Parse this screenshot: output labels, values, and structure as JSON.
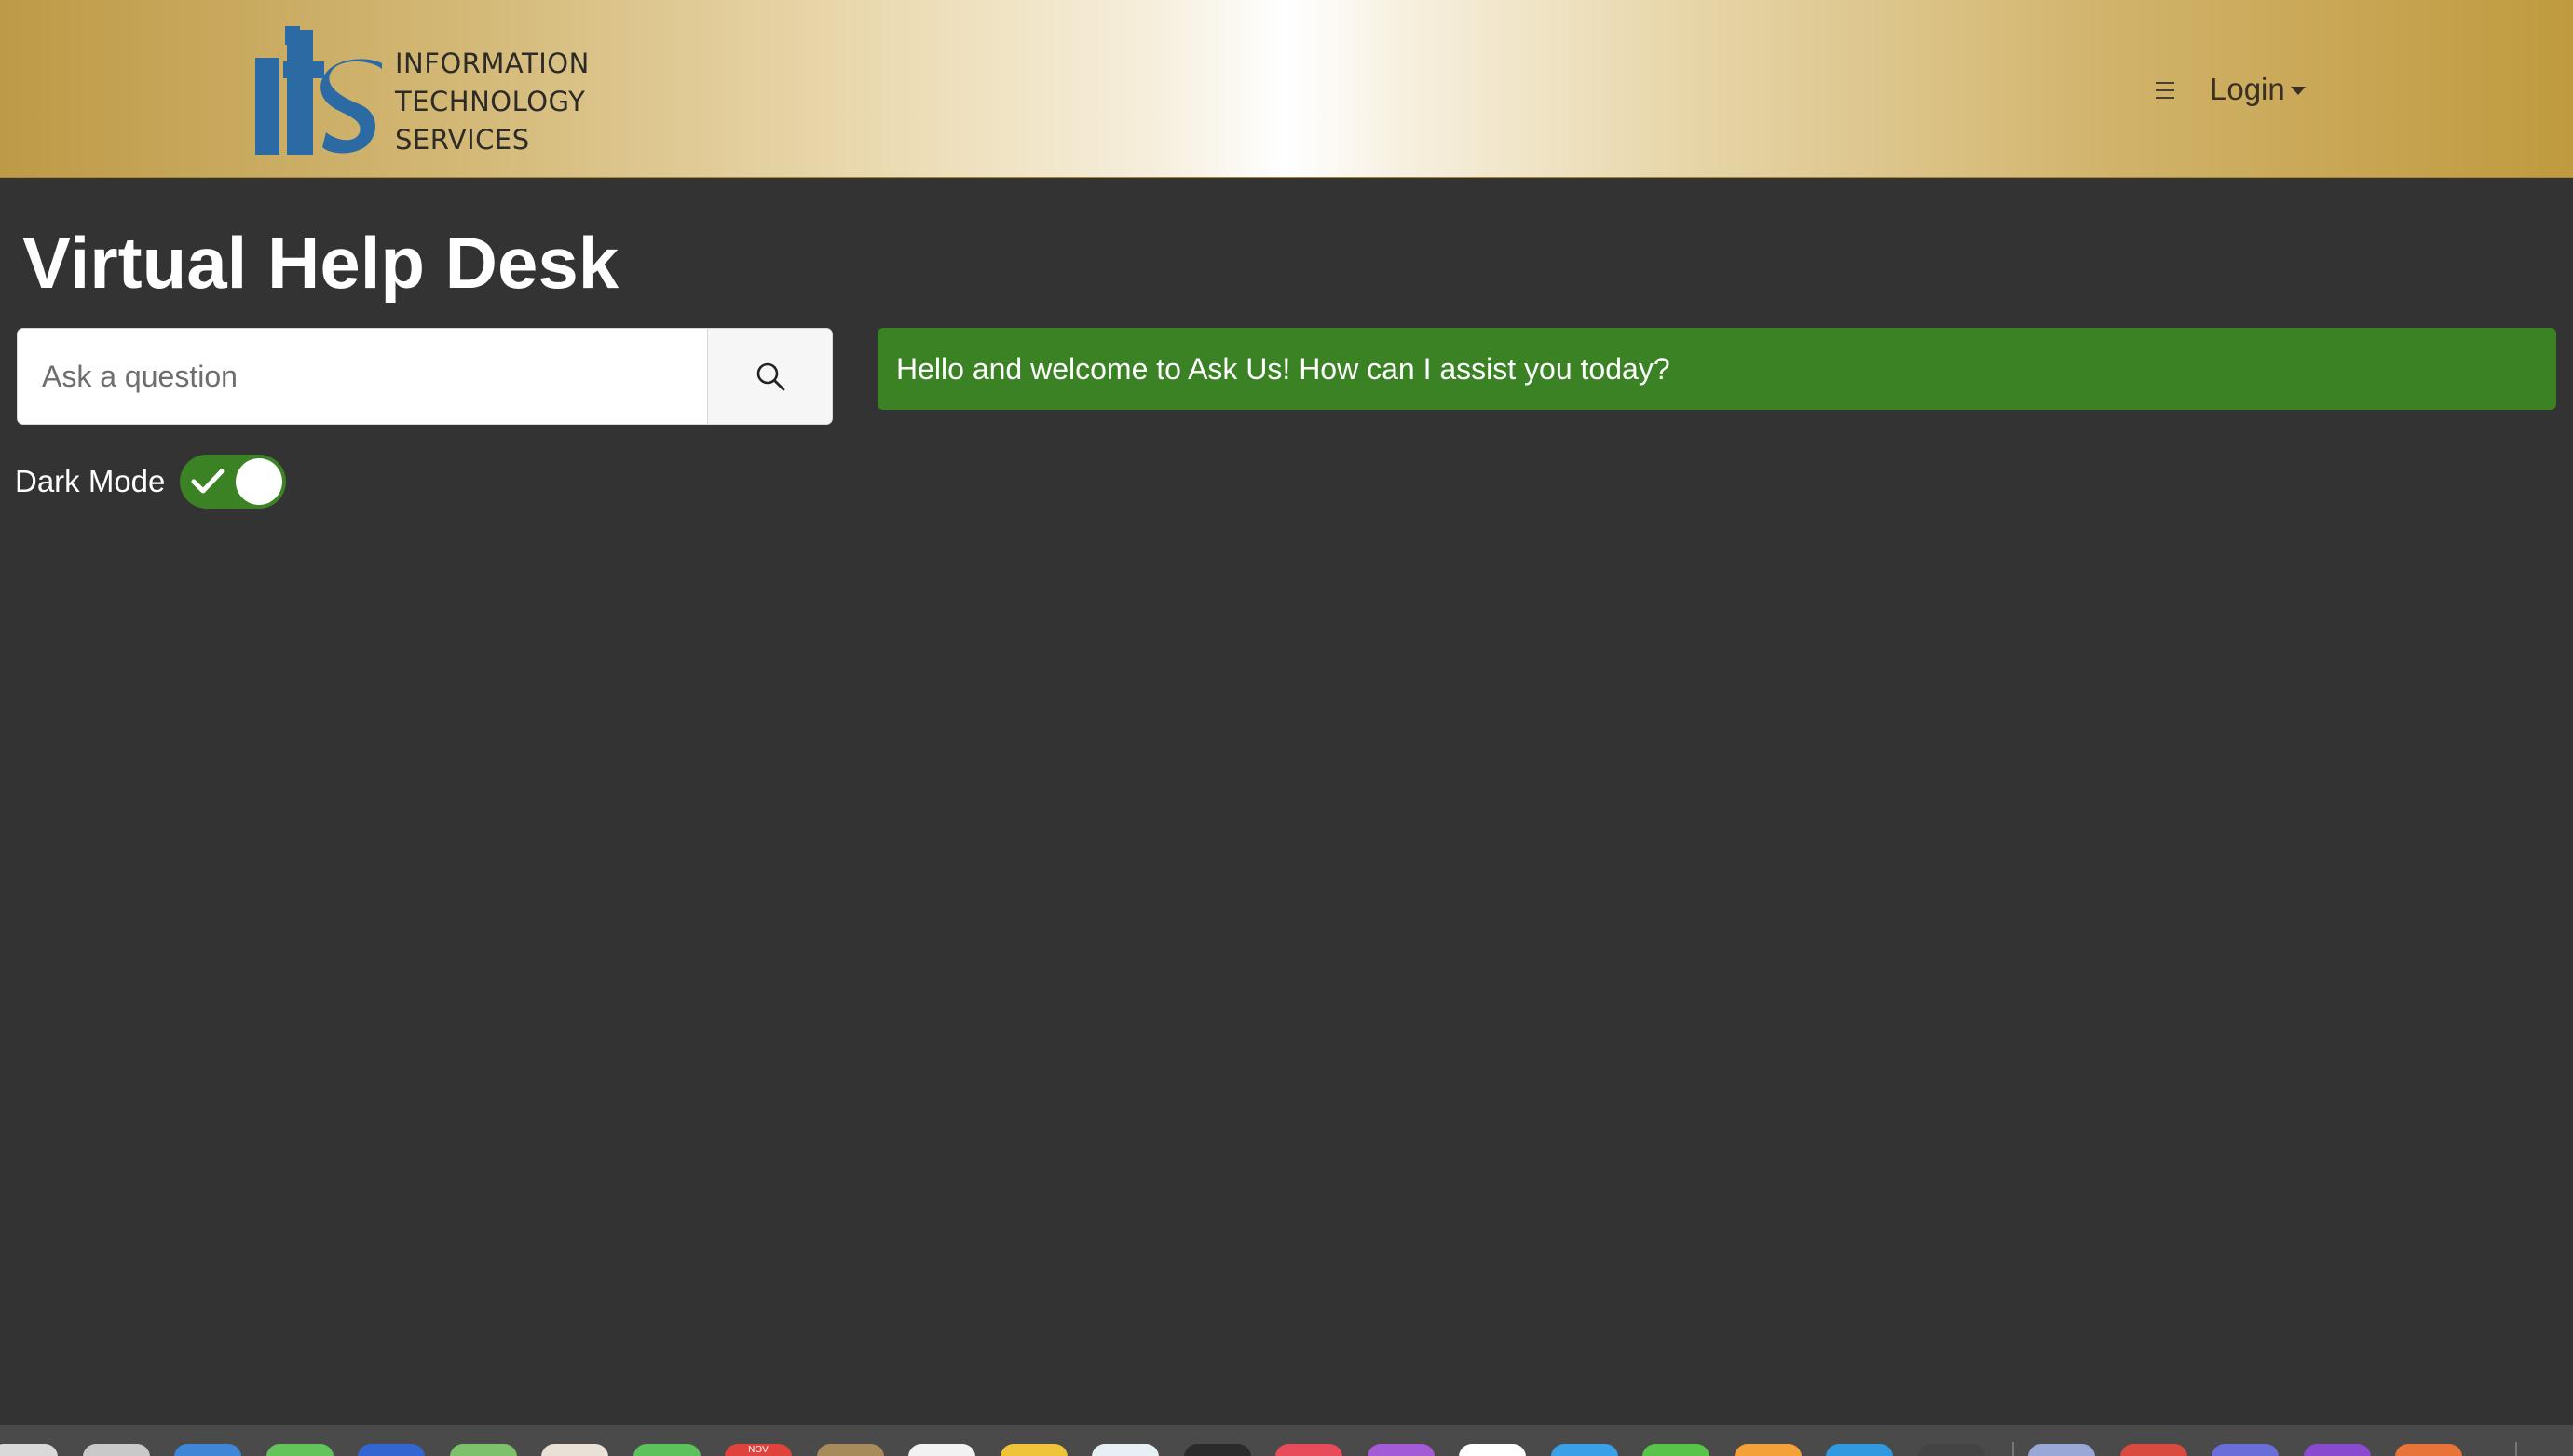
{
  "header": {
    "logo_text_lines": [
      "INFORMATION",
      "TECHNOLOGY",
      "SERVICES"
    ],
    "login_label": "Login"
  },
  "main": {
    "title": "Virtual Help Desk",
    "search": {
      "placeholder": "Ask a question",
      "value": ""
    },
    "dark_mode": {
      "label": "Dark Mode",
      "checked": true
    },
    "welcome_message": "Hello and welcome to Ask Us! How can I assist you today?"
  },
  "dock": {
    "calendar_month": "NOV",
    "icon_colors": [
      "#d9d9d9",
      "#c9c9c9",
      "#3f86d6",
      "#62c45a",
      "#3366d1",
      "#7dc26b",
      "#e9e0d6",
      "#5cc25b",
      "#e0433c",
      "#a88b5a",
      "#f2f2f2",
      "#f0c43a",
      "#e6f0f5",
      "#2b2b2b",
      "#e84b5a",
      "#a45bd6",
      "#ffffff",
      "#3aa0e8",
      "#58c44a",
      "#f3a23a",
      "#2f9ae0",
      "#444444",
      "#9aa8d8",
      "#d94a3f",
      "#6a6ed8",
      "#8a4ad0",
      "#e8743a"
    ]
  },
  "colors": {
    "accent_green": "#3a8224",
    "background": "#333333",
    "header_gold": "#bd9a46",
    "logo_blue": "#2c6aa3"
  }
}
